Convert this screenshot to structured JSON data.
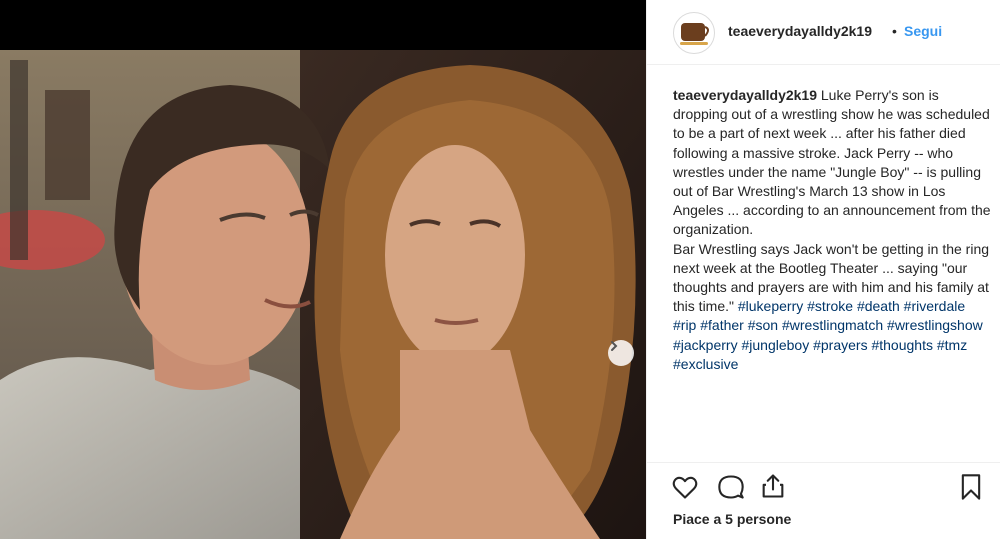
{
  "post": {
    "author": "teaeverydayalldy2k19",
    "follow_label": "Segui",
    "dot": "•",
    "caption_text": " Luke Perry's son is dropping out of a wrestling show he was scheduled to be a part of next week ... after his father died following a massive stroke. Jack Perry -- who wrestles under the name \"Jungle Boy\" -- is pulling out of Bar Wrestling's March 13 show in Los Angeles ... according to an announcement from the organization.",
    "caption_text_2": "Bar Wrestling says Jack won't be getting in the ring next week at the Bootleg Theater ... saying \"our thoughts and prayers are with him and his family at this time.\" ",
    "hashtags": [
      "#lukeperry",
      "#stroke",
      "#death",
      "#riverdale",
      "#rip",
      "#father",
      "#son",
      "#wrestlingmatch",
      "#wrestlingshow",
      "#jackperry",
      "#jungleboy",
      "#prayers",
      "#thoughts",
      "#tmz",
      "#exclusive"
    ],
    "likes_label": "Piace a 5 persone"
  },
  "icons": {
    "like": "heart-icon",
    "comment": "comment-icon",
    "share": "share-icon",
    "save": "bookmark-icon",
    "next": "chevron-right-icon"
  },
  "colors": {
    "follow": "#3897f0",
    "hashtag": "#003569",
    "text": "#262626"
  }
}
